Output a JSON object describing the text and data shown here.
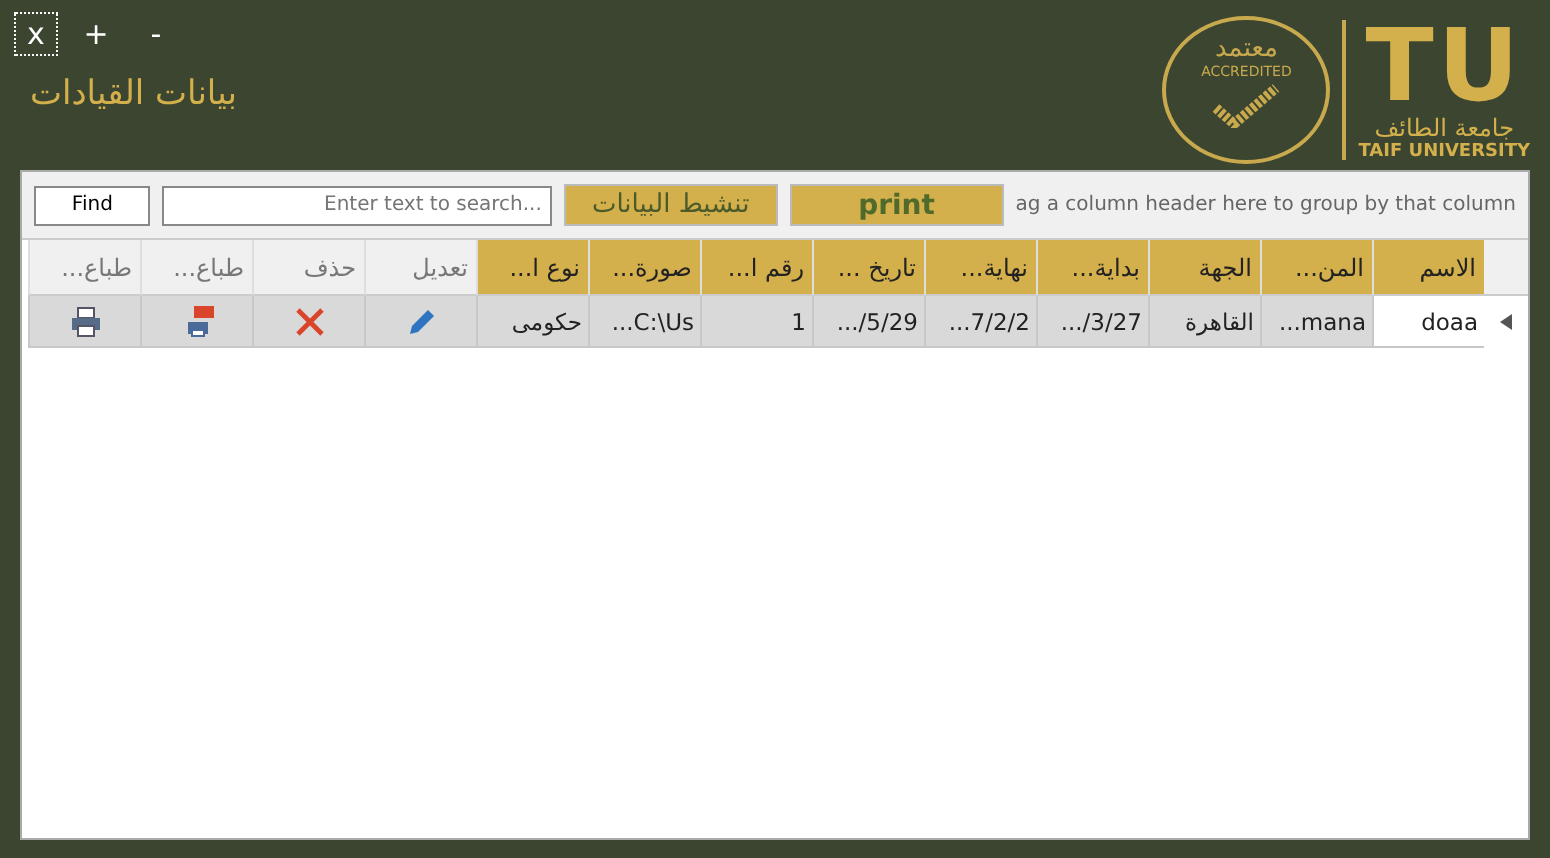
{
  "window_controls": [
    {
      "label": "-",
      "focused": false
    },
    {
      "label": "+",
      "focused": false
    },
    {
      "label": "x",
      "focused": true
    }
  ],
  "title": "بيانات القيادات",
  "logo": {
    "seal_text": "معتمد",
    "seal_caption": "ACCREDITED",
    "mark": "TU",
    "name_ar": "جامعة الطائف",
    "name_en": "TAIF UNIVERSITY"
  },
  "toolbar": {
    "find_button": "Find",
    "search": {
      "placeholder": "Enter text to search..."
    },
    "refresh_button": "تنشيط البيانات",
    "print_button": "print",
    "group_hint": "ag a column header here to group by that column"
  },
  "table": {
    "columns": [
      {
        "label": "الاسم",
        "kind": "data"
      },
      {
        "label": "المن...",
        "kind": "data"
      },
      {
        "label": "الجهة",
        "kind": "data"
      },
      {
        "label": "بداية...",
        "kind": "data"
      },
      {
        "label": "نهاية...",
        "kind": "data"
      },
      {
        "label": "تاريخ ...",
        "kind": "data"
      },
      {
        "label": "رقم ا...",
        "kind": "data"
      },
      {
        "label": "صورة...",
        "kind": "data"
      },
      {
        "label": "نوع ا...",
        "kind": "data"
      },
      {
        "label": "تعديل",
        "kind": "action"
      },
      {
        "label": "حذف",
        "kind": "action"
      },
      {
        "label": "طباع...",
        "kind": "action"
      },
      {
        "label": "طباع...",
        "kind": "action"
      }
    ],
    "rows": [
      {
        "current": true,
        "cells": [
          {
            "kind": "text",
            "text": "doaa",
            "focused": true
          },
          {
            "kind": "text",
            "text": "...mana",
            "focused": false
          },
          {
            "kind": "text",
            "text": "القاهرة",
            "focused": false
          },
          {
            "kind": "text",
            "text": ".../3/27",
            "focused": false
          },
          {
            "kind": "text",
            "text": "...7/2/2",
            "focused": false
          },
          {
            "kind": "text",
            "text": ".../5/29",
            "focused": false
          },
          {
            "kind": "text",
            "text": "1",
            "focused": false
          },
          {
            "kind": "text",
            "text": "...C:\\Us",
            "focused": false
          },
          {
            "kind": "text",
            "text": "حكومى",
            "focused": false
          },
          {
            "kind": "edit"
          },
          {
            "kind": "delete"
          },
          {
            "kind": "pdf"
          },
          {
            "kind": "print"
          }
        ]
      }
    ]
  }
}
